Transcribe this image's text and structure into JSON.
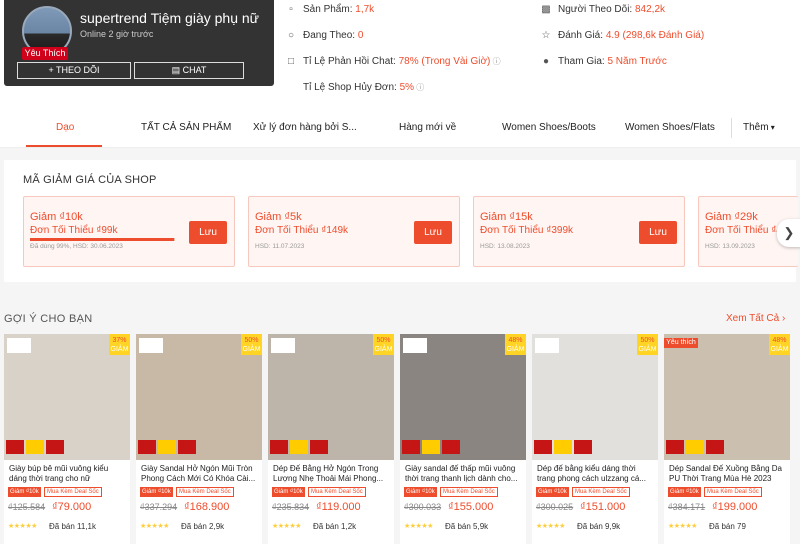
{
  "shop": {
    "name": "supertrend Tiệm giày phụ nữ",
    "badge": "Yêu Thích",
    "online": "Online 2 giờ trước",
    "follow_label": "THEO DÕI",
    "chat_label": "CHAT"
  },
  "stats": {
    "products_label": "Sản Phẩm:",
    "products_value": "1,7k",
    "following_label": "Đang Theo:",
    "following_value": "0",
    "chat_response_label": "Tỉ Lệ Phản Hồi Chat:",
    "chat_response_value": "78% (Trong Vài Giờ)",
    "cancel_label": "Tỉ Lệ Shop Hủy Đơn:",
    "cancel_value": "5%",
    "followers_label": "Người Theo Dõi:",
    "followers_value": "842,2k",
    "rating_label": "Đánh Giá:",
    "rating_value": "4.9 (298,6k Đánh Giá)",
    "joined_label": "Tham Gia:",
    "joined_value": "5 Năm Trước"
  },
  "tabs": [
    "Dạo",
    "TẤT CẢ SẢN PHẨM",
    "Xử lý đơn hàng bởi S...",
    "Hàng mới về",
    "Women Shoes/Boots",
    "Women Shoes/Flats",
    "Thêm"
  ],
  "vouchers": {
    "title": "MÃ GIẢM GIÁ CỦA SHOP",
    "save_label": "Lưu",
    "items": [
      {
        "discount": "Giảm ₫10k",
        "min": "Đơn Tối Thiểu ₫99k",
        "note": "Đã dùng 99%, HSD: 30.06.2023",
        "used": 0.99
      },
      {
        "discount": "Giảm ₫5k",
        "min": "Đơn Tối Thiểu ₫149k",
        "note": "HSD: 11.07.2023"
      },
      {
        "discount": "Giảm ₫15k",
        "min": "Đơn Tối Thiểu ₫399k",
        "note": "HSD: 13.08.2023"
      },
      {
        "discount": "Giảm ₫29k",
        "min": "Đơn Tối Thiểu ₫4",
        "note": "HSD: 13.09.2023"
      }
    ]
  },
  "suggest": {
    "title": "GỢI Ý CHO BẠN",
    "see_all": "Xem Tất Cả",
    "discount_word": "GIẢM",
    "tag1": "Giảm ₫10k",
    "tag2": "Mua Kèm Deal Sốc",
    "products": [
      {
        "name": "Giày búp bê mũi vuông kiểu dáng thời trang cho nữ",
        "disc": "37%",
        "old": "₫125.584",
        "new": "₫79.000",
        "sold": "Đã bán 11,1k"
      },
      {
        "name": "Giày Sandal Hở Ngón Mũi Tròn Phong Cách Mới Có Khóa Cài...",
        "disc": "50%",
        "old": "₫337.294",
        "new": "₫168.900",
        "sold": "Đã bán 2,9k"
      },
      {
        "name": "Dép Đế Bằng Hở Ngón Trong Lượng Nhẹ Thoải Mái Phong...",
        "disc": "50%",
        "old": "₫235.834",
        "new": "₫119.000",
        "sold": "Đã bán 1,2k"
      },
      {
        "name": "Giày sandal đế thấp mũi vuông thời trang thanh lịch dành cho...",
        "disc": "48%",
        "old": "₫300.033",
        "new": "₫155.000",
        "sold": "Đã bán 5,9k"
      },
      {
        "name": "Dép đế bằng kiểu dáng thời trang phong cách ulzzang cá...",
        "disc": "50%",
        "old": "₫300.025",
        "new": "₫151.000",
        "sold": "Đã bán 9,9k"
      },
      {
        "name": "Dép Sandal Đế Xuồng Bằng Da PU Thời Trang Mùa Hè 2023",
        "disc": "48%",
        "old": "₫384.171",
        "new": "₫199.000",
        "sold": "Đã bán 79",
        "fav": "Yêu thích"
      }
    ]
  },
  "colors": {
    "accent": "#ee4d2d",
    "dark_card": "#333333",
    "badge_yellow": "#ffd424"
  }
}
